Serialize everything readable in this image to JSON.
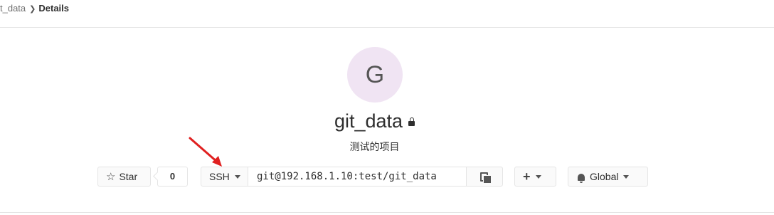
{
  "breadcrumb": {
    "parent": "t_data",
    "current": "Details"
  },
  "project": {
    "avatar_letter": "G",
    "name": "git_data",
    "description": "测试的项目",
    "avatar_color": "#f0e4f3"
  },
  "actions": {
    "star_label": "Star",
    "star_count": "0",
    "protocol": "SSH",
    "clone_url": "git@192.168.1.10:test/git_data",
    "notification_label": "Global"
  },
  "icons": {
    "star": "star-icon",
    "lock": "lock-icon",
    "copy": "clipboard-icon",
    "plus": "plus-icon",
    "bell": "bell-icon",
    "chevron": "chevron-right-icon",
    "caret": "caret-down-icon"
  },
  "colors": {
    "annotation_arrow": "#e02020"
  }
}
